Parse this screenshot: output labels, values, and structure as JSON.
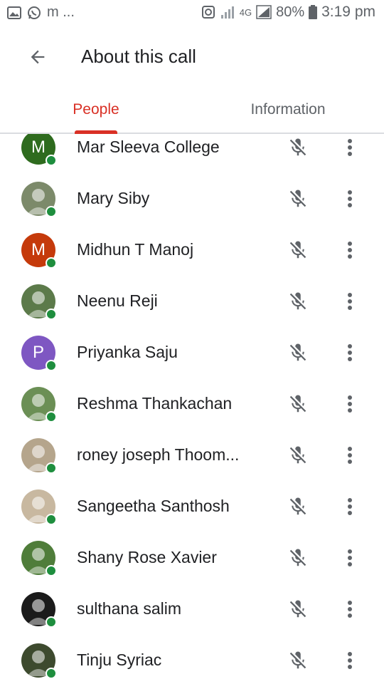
{
  "status_bar": {
    "left_icons": [
      "image-icon",
      "whatsapp-icon",
      "m-app-icon"
    ],
    "left_text": "m ...",
    "network": "4G",
    "battery": "80%",
    "time": "3:19 pm"
  },
  "header": {
    "title": "About this call"
  },
  "tabs": [
    {
      "label": "People",
      "active": true
    },
    {
      "label": "Information",
      "active": false
    }
  ],
  "colors": {
    "accent": "#d93025",
    "online": "#1e8e3e"
  },
  "participants": [
    {
      "name": "Mar Sleeva College",
      "initial": "M",
      "avatar_color": "#2e6b1e",
      "online": true,
      "muted": true
    },
    {
      "name": "Mary Siby",
      "initial": "",
      "avatar_color": "#7c8a6a",
      "online": true,
      "muted": true
    },
    {
      "name": "Midhun T Manoj",
      "initial": "M",
      "avatar_color": "#c53a0b",
      "online": true,
      "muted": true
    },
    {
      "name": "Neenu Reji",
      "initial": "",
      "avatar_color": "#5c7a4a",
      "online": true,
      "muted": true
    },
    {
      "name": "Priyanka Saju",
      "initial": "P",
      "avatar_color": "#7e57c2",
      "online": true,
      "muted": true
    },
    {
      "name": "Reshma Thankachan",
      "initial": "",
      "avatar_color": "#6b8f55",
      "online": true,
      "muted": true
    },
    {
      "name": "roney joseph Thoom...",
      "initial": "",
      "avatar_color": "#b5a58c",
      "online": true,
      "muted": true
    },
    {
      "name": "Sangeetha Santhosh",
      "initial": "",
      "avatar_color": "#c8b8a0",
      "online": true,
      "muted": true
    },
    {
      "name": "Shany Rose Xavier",
      "initial": "",
      "avatar_color": "#4f7d3a",
      "online": true,
      "muted": true
    },
    {
      "name": "sulthana salim",
      "initial": "",
      "avatar_color": "#1b1b1b",
      "online": true,
      "muted": true
    },
    {
      "name": "Tinju Syriac",
      "initial": "",
      "avatar_color": "#3d4a2e",
      "online": true,
      "muted": true
    }
  ]
}
